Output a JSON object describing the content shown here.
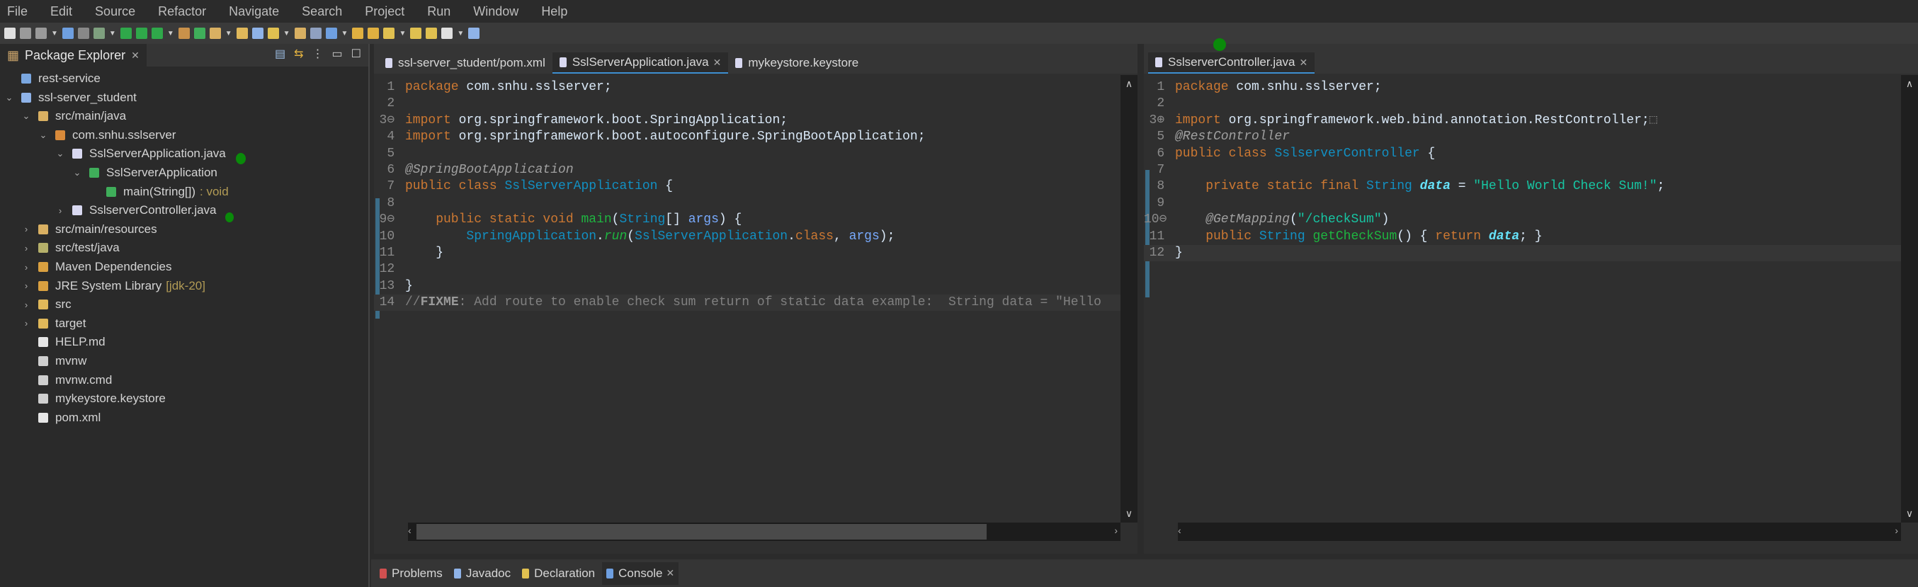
{
  "menu": [
    "File",
    "Edit",
    "Source",
    "Refactor",
    "Navigate",
    "Search",
    "Project",
    "Run",
    "Window",
    "Help"
  ],
  "package_explorer": {
    "title": "Package Explorer",
    "items": [
      {
        "label": "rest-service",
        "depth": 0,
        "twisty": "",
        "icon": "project-folder-icon",
        "color": "#7aa7e0"
      },
      {
        "label": "ssl-server_student",
        "depth": 0,
        "twisty": "v",
        "icon": "maven-project-icon",
        "color": "#8fb3e8"
      },
      {
        "label": "src/main/java",
        "depth": 1,
        "twisty": "v",
        "icon": "source-folder-icon",
        "color": "#d9b062"
      },
      {
        "label": "com.snhu.sslserver",
        "depth": 2,
        "twisty": "v",
        "icon": "package-icon",
        "color": "#d98a3a"
      },
      {
        "label": "SslServerApplication.java",
        "depth": 3,
        "twisty": "v",
        "icon": "java-file-icon",
        "color": "#d8d8f0"
      },
      {
        "label": "SslServerApplication",
        "depth": 4,
        "twisty": "v",
        "icon": "class-icon",
        "color": "#3fae5a"
      },
      {
        "label": "main(String[])",
        "suffix": ": void",
        "depth": 5,
        "twisty": "",
        "icon": "method-icon",
        "color": "#3fae5a"
      },
      {
        "label": "SslserverController.java",
        "depth": 3,
        "twisty": ">",
        "icon": "java-file-icon",
        "color": "#d8d8f0"
      },
      {
        "label": "src/main/resources",
        "depth": 1,
        "twisty": ">",
        "icon": "source-folder-icon",
        "color": "#d9b062"
      },
      {
        "label": "src/test/java",
        "depth": 1,
        "twisty": ">",
        "icon": "test-folder-icon",
        "color": "#b5b06a"
      },
      {
        "label": "Maven Dependencies",
        "depth": 1,
        "twisty": ">",
        "icon": "library-icon",
        "color": "#d9a040"
      },
      {
        "label": "JRE System Library",
        "suffix": "[jdk-20]",
        "depth": 1,
        "twisty": ">",
        "icon": "library-icon",
        "color": "#d9a040"
      },
      {
        "label": "src",
        "depth": 1,
        "twisty": ">",
        "icon": "folder-icon",
        "color": "#e0b85a"
      },
      {
        "label": "target",
        "depth": 1,
        "twisty": ">",
        "icon": "folder-icon",
        "color": "#e0b85a"
      },
      {
        "label": "HELP.md",
        "depth": 1,
        "twisty": "",
        "icon": "markdown-file-icon",
        "color": "#e6e6e6"
      },
      {
        "label": "mvnw",
        "depth": 1,
        "twisty": "",
        "icon": "file-icon",
        "color": "#cfcfcf"
      },
      {
        "label": "mvnw.cmd",
        "depth": 1,
        "twisty": "",
        "icon": "file-icon",
        "color": "#cfcfcf"
      },
      {
        "label": "mykeystore.keystore",
        "depth": 1,
        "twisty": "",
        "icon": "file-icon",
        "color": "#cfcfcf"
      },
      {
        "label": "pom.xml",
        "depth": 1,
        "twisty": "",
        "icon": "maven-file-icon",
        "color": "#e6e6e6"
      }
    ]
  },
  "editor_left": {
    "tabs": [
      {
        "label": "ssl-server_student/pom.xml",
        "active": false,
        "close": false
      },
      {
        "label": "SslServerApplication.java",
        "active": true,
        "close": true
      },
      {
        "label": "mykeystore.keystore",
        "active": false,
        "close": false
      }
    ],
    "lines": [
      {
        "n": "1",
        "t": [
          [
            "package",
            "kw"
          ],
          [
            " com.snhu.sslserver;",
            "pl"
          ]
        ]
      },
      {
        "n": "2",
        "t": []
      },
      {
        "n": "3⊖",
        "t": [
          [
            "import",
            "kw"
          ],
          [
            " org.springframework.boot.SpringApplication;",
            "pl"
          ]
        ]
      },
      {
        "n": "4",
        "t": [
          [
            "import",
            "kw"
          ],
          [
            " org.springframework.boot.autoconfigure.SpringBootApplication;",
            "pl"
          ]
        ]
      },
      {
        "n": "5",
        "t": []
      },
      {
        "n": "6",
        "t": [
          [
            "@SpringBootApplication",
            "ann"
          ]
        ]
      },
      {
        "n": "7",
        "t": [
          [
            "public class ",
            "kw"
          ],
          [
            "SslServerApplication",
            "cls"
          ],
          [
            " {",
            "pl"
          ]
        ]
      },
      {
        "n": "8",
        "t": []
      },
      {
        "n": "9⊖",
        "t": [
          [
            "    public static void ",
            "kw"
          ],
          [
            "main",
            "mth"
          ],
          [
            "(",
            "pl"
          ],
          [
            "String",
            "cls"
          ],
          [
            "[] ",
            "pl"
          ],
          [
            "args",
            "par"
          ],
          [
            ") {",
            "pl"
          ]
        ]
      },
      {
        "n": "10",
        "t": [
          [
            "        SpringApplication",
            "cls"
          ],
          [
            ".",
            "pl"
          ],
          [
            "run",
            "itl"
          ],
          [
            "(",
            "pl"
          ],
          [
            "SslServerApplication",
            "cls"
          ],
          [
            ".",
            "pl"
          ],
          [
            "class",
            "kw"
          ],
          [
            ", ",
            "pl"
          ],
          [
            "args",
            "par"
          ],
          [
            ");",
            "pl"
          ]
        ]
      },
      {
        "n": "11",
        "t": [
          [
            "    }",
            "pl"
          ]
        ]
      },
      {
        "n": "12",
        "t": []
      },
      {
        "n": "13",
        "t": [
          [
            "}",
            "pl"
          ]
        ]
      },
      {
        "n": "14",
        "t": [
          [
            "//",
            "cmt"
          ],
          [
            "FIXME",
            "cmtb"
          ],
          [
            ": Add route to enable check sum return of static data example:  String data = \"Hello",
            "cmt"
          ]
        ]
      }
    ]
  },
  "editor_right": {
    "tabs": [
      {
        "label": "SslserverController.java",
        "active": true,
        "close": true
      }
    ],
    "lines": [
      {
        "n": "1",
        "t": [
          [
            "package",
            "kw"
          ],
          [
            " com.snhu.sslserver;",
            "pl"
          ]
        ]
      },
      {
        "n": "2",
        "t": []
      },
      {
        "n": "3⊕",
        "t": [
          [
            "import",
            "kw"
          ],
          [
            " org.springframework.web.bind.annotation.RestController;",
            "pl"
          ],
          [
            "⬚",
            "cmt"
          ]
        ]
      },
      {
        "n": "5",
        "t": [
          [
            "@RestController",
            "ann"
          ]
        ]
      },
      {
        "n": "6",
        "t": [
          [
            "public class ",
            "kw"
          ],
          [
            "SslserverController",
            "cls"
          ],
          [
            " {",
            "pl"
          ]
        ]
      },
      {
        "n": "7",
        "t": []
      },
      {
        "n": "8",
        "t": [
          [
            "    private static final ",
            "kw"
          ],
          [
            "String",
            "cls"
          ],
          [
            " ",
            "pl"
          ],
          [
            "data",
            "fld"
          ],
          [
            " = ",
            "pl"
          ],
          [
            "\"Hello World Check Sum!\"",
            "str"
          ],
          [
            ";",
            "pl"
          ]
        ]
      },
      {
        "n": "9",
        "t": []
      },
      {
        "n": "10⊖",
        "t": [
          [
            "    @GetMapping",
            "ann"
          ],
          [
            "(",
            "pl"
          ],
          [
            "\"/checkSum\"",
            "str"
          ],
          [
            ")",
            "pl"
          ]
        ]
      },
      {
        "n": "11",
        "t": [
          [
            "    public ",
            "kw"
          ],
          [
            "String",
            "cls"
          ],
          [
            " ",
            "pl"
          ],
          [
            "getCheckSum",
            "mth"
          ],
          [
            "() { ",
            "pl"
          ],
          [
            "return",
            "kw"
          ],
          [
            " ",
            "pl"
          ],
          [
            "data",
            "fld"
          ],
          [
            "; }",
            "pl"
          ]
        ]
      },
      {
        "n": "12",
        "t": [
          [
            "}",
            "pl"
          ]
        ]
      }
    ]
  },
  "bottom_tabs": [
    {
      "label": "Problems",
      "icon": "problems-icon"
    },
    {
      "label": "Javadoc",
      "icon": "javadoc-icon"
    },
    {
      "label": "Declaration",
      "icon": "declaration-icon"
    },
    {
      "label": "Console",
      "icon": "console-icon",
      "active": true
    }
  ]
}
